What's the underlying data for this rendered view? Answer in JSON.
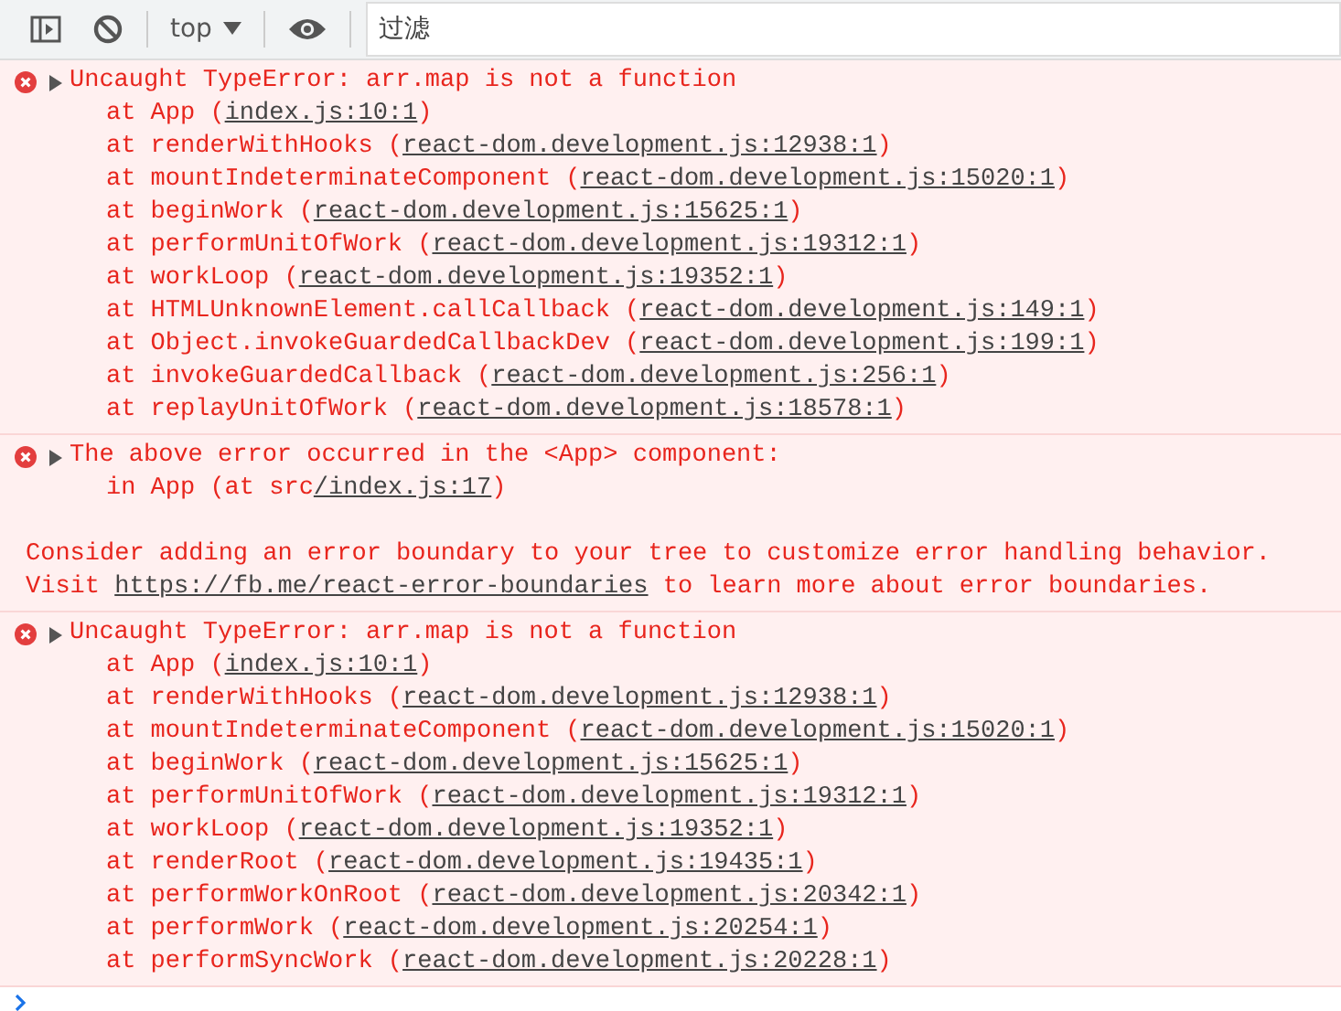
{
  "toolbar": {
    "context": "top",
    "filter": {
      "placeholder": "过滤"
    }
  },
  "messages": [
    {
      "expanded": false,
      "header": "Uncaught TypeError: arr.map is not a function",
      "stack": [
        [
          {
            "text": "at App ("
          },
          {
            "text": "index.js:10:1",
            "link": true
          },
          {
            "text": ")"
          }
        ],
        [
          {
            "text": "at renderWithHooks ("
          },
          {
            "text": "react-dom.development.js:12938:1",
            "link": true
          },
          {
            "text": ")"
          }
        ],
        [
          {
            "text": "at mountIndeterminateComponent ("
          },
          {
            "text": "react-dom.development.js:15020:1",
            "link": true
          },
          {
            "text": ")"
          }
        ],
        [
          {
            "text": "at beginWork ("
          },
          {
            "text": "react-dom.development.js:15625:1",
            "link": true
          },
          {
            "text": ")"
          }
        ],
        [
          {
            "text": "at performUnitOfWork ("
          },
          {
            "text": "react-dom.development.js:19312:1",
            "link": true
          },
          {
            "text": ")"
          }
        ],
        [
          {
            "text": "at workLoop ("
          },
          {
            "text": "react-dom.development.js:19352:1",
            "link": true
          },
          {
            "text": ")"
          }
        ],
        [
          {
            "text": "at HTMLUnknownElement.callCallback ("
          },
          {
            "text": "react-dom.development.js:149:1",
            "link": true
          },
          {
            "text": ")"
          }
        ],
        [
          {
            "text": "at Object.invokeGuardedCallbackDev ("
          },
          {
            "text": "react-dom.development.js:199:1",
            "link": true
          },
          {
            "text": ")"
          }
        ],
        [
          {
            "text": "at invokeGuardedCallback ("
          },
          {
            "text": "react-dom.development.js:256:1",
            "link": true
          },
          {
            "text": ")"
          }
        ],
        [
          {
            "text": "at replayUnitOfWork ("
          },
          {
            "text": "react-dom.development.js:18578:1",
            "link": true
          },
          {
            "text": ")"
          }
        ]
      ]
    },
    {
      "expanded": false,
      "header": "The above error occurred in the <App> component:",
      "stack": [
        [
          {
            "text": "in App (at src"
          },
          {
            "text": "/index.js:17",
            "link": true
          },
          {
            "text": ")"
          }
        ]
      ],
      "note": [
        [
          {
            "text": "Consider adding an error boundary to your tree to customize error handling behavior."
          }
        ],
        [
          {
            "text": "Visit "
          },
          {
            "text": "https://fb.me/react-error-boundaries",
            "link": true
          },
          {
            "text": " to learn more about error boundaries."
          }
        ]
      ]
    },
    {
      "expanded": false,
      "header": "Uncaught TypeError: arr.map is not a function",
      "stack": [
        [
          {
            "text": "at App ("
          },
          {
            "text": "index.js:10:1",
            "link": true
          },
          {
            "text": ")"
          }
        ],
        [
          {
            "text": "at renderWithHooks ("
          },
          {
            "text": "react-dom.development.js:12938:1",
            "link": true
          },
          {
            "text": ")"
          }
        ],
        [
          {
            "text": "at mountIndeterminateComponent ("
          },
          {
            "text": "react-dom.development.js:15020:1",
            "link": true
          },
          {
            "text": ")"
          }
        ],
        [
          {
            "text": "at beginWork ("
          },
          {
            "text": "react-dom.development.js:15625:1",
            "link": true
          },
          {
            "text": ")"
          }
        ],
        [
          {
            "text": "at performUnitOfWork ("
          },
          {
            "text": "react-dom.development.js:19312:1",
            "link": true
          },
          {
            "text": ")"
          }
        ],
        [
          {
            "text": "at workLoop ("
          },
          {
            "text": "react-dom.development.js:19352:1",
            "link": true
          },
          {
            "text": ")"
          }
        ],
        [
          {
            "text": "at renderRoot ("
          },
          {
            "text": "react-dom.development.js:19435:1",
            "link": true
          },
          {
            "text": ")"
          }
        ],
        [
          {
            "text": "at performWorkOnRoot ("
          },
          {
            "text": "react-dom.development.js:20342:1",
            "link": true
          },
          {
            "text": ")"
          }
        ],
        [
          {
            "text": "at performWork ("
          },
          {
            "text": "react-dom.development.js:20254:1",
            "link": true
          },
          {
            "text": ")"
          }
        ],
        [
          {
            "text": "at performSyncWork ("
          },
          {
            "text": "react-dom.development.js:20228:1",
            "link": true
          },
          {
            "text": ")"
          }
        ]
      ]
    }
  ]
}
